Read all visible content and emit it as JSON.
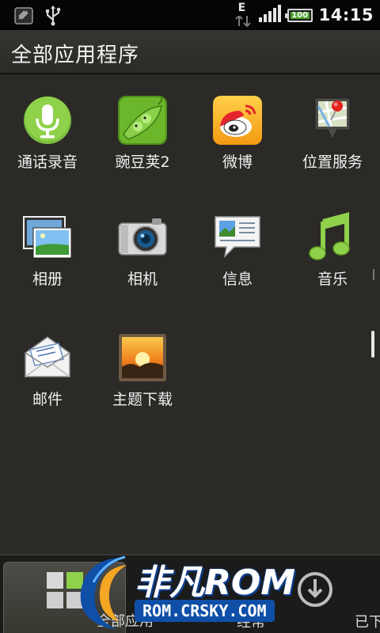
{
  "status_bar": {
    "network_type": "E",
    "battery_level": "100",
    "time": "14:15",
    "icons": [
      "notification-icon",
      "usb-icon",
      "data-arrows-icon",
      "signal-icon",
      "battery-icon"
    ]
  },
  "header": {
    "title": "全部应用程序"
  },
  "apps": [
    {
      "label": "通话录音",
      "icon": "microphone-icon"
    },
    {
      "label": "豌豆荚2",
      "icon": "pea-pod-icon"
    },
    {
      "label": "微博",
      "icon": "weibo-icon"
    },
    {
      "label": "位置服务",
      "icon": "map-pin-icon"
    },
    {
      "label": "相册",
      "icon": "photo-album-icon"
    },
    {
      "label": "相机",
      "icon": "camera-icon"
    },
    {
      "label": "信息",
      "icon": "message-icon"
    },
    {
      "label": "音乐",
      "icon": "music-note-icon"
    },
    {
      "label": "邮件",
      "icon": "mail-icon"
    },
    {
      "label": "主题下载",
      "icon": "theme-picture-icon"
    }
  ],
  "tabs": [
    {
      "label": "全部应用"
    },
    {
      "label": "经常"
    },
    {
      "label": "已下载"
    }
  ],
  "watermark": {
    "brand": "非凡ROM",
    "url": "ROM.CRSKY.COM"
  },
  "colors": {
    "background": "#2b2a27",
    "status_bar": "#050505",
    "battery": "#4aa12f"
  }
}
